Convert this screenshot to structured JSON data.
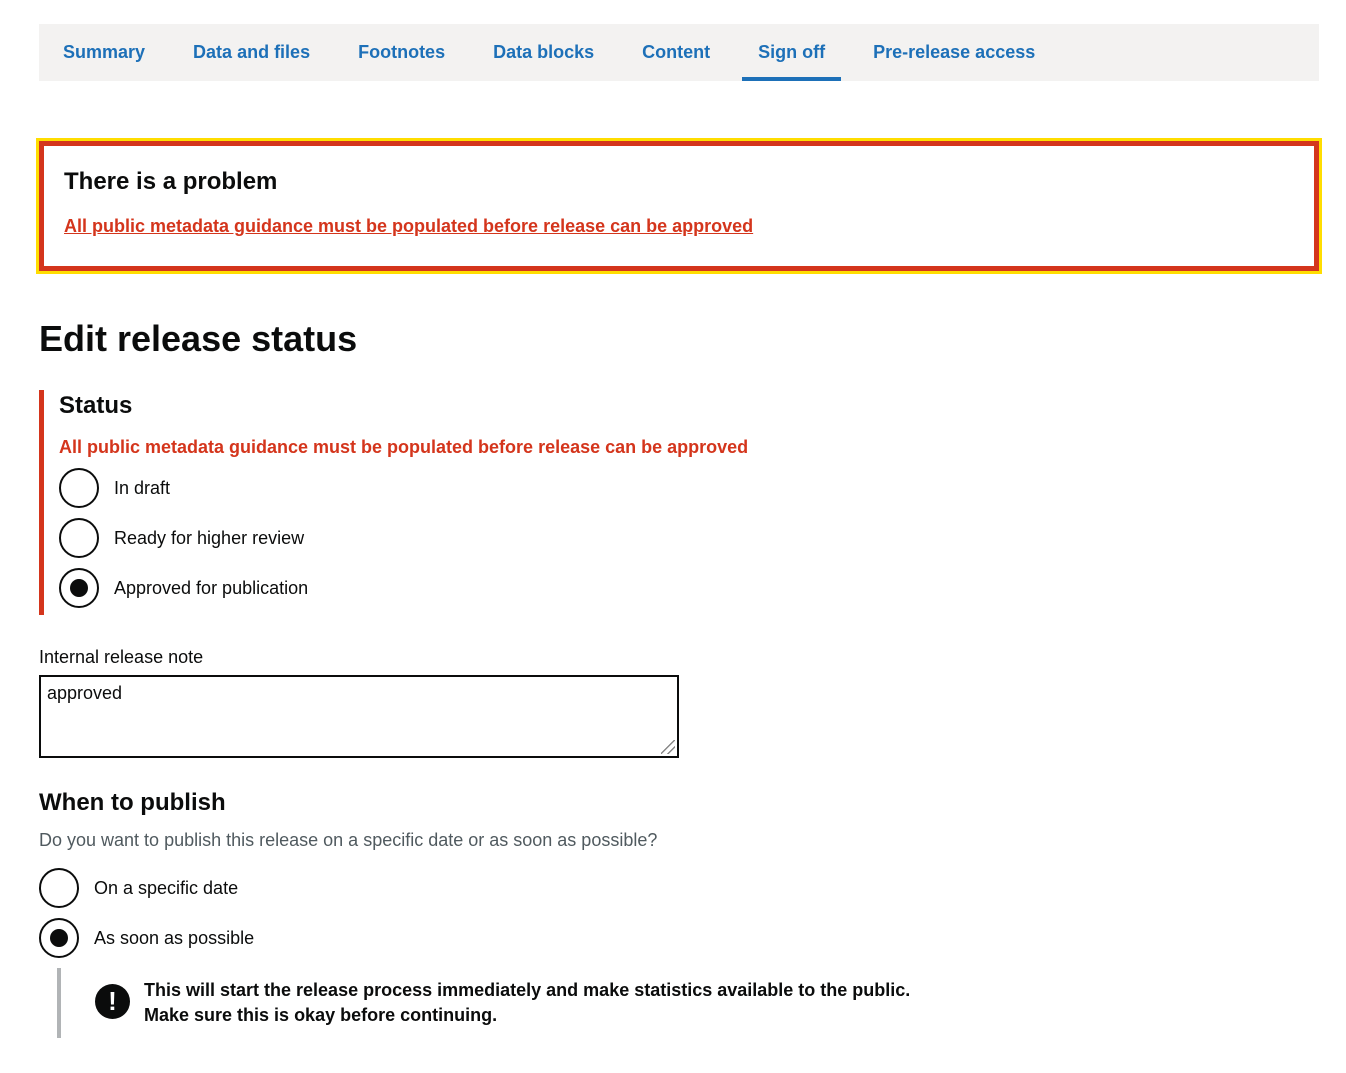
{
  "nav": {
    "tabs": [
      {
        "label": "Summary",
        "active": false
      },
      {
        "label": "Data and files",
        "active": false
      },
      {
        "label": "Footnotes",
        "active": false
      },
      {
        "label": "Data blocks",
        "active": false
      },
      {
        "label": "Content",
        "active": false
      },
      {
        "label": "Sign off",
        "active": true
      },
      {
        "label": "Pre-release access",
        "active": false
      }
    ]
  },
  "error_summary": {
    "title": "There is a problem",
    "link": "All public metadata guidance must be populated before release can be approved"
  },
  "page_title": "Edit release status",
  "status": {
    "legend": "Status",
    "error": "All public metadata guidance must be populated before release can be approved",
    "options": [
      {
        "label": "In draft",
        "checked": false
      },
      {
        "label": "Ready for higher review",
        "checked": false
      },
      {
        "label": "Approved for publication",
        "checked": true
      }
    ]
  },
  "release_note": {
    "label": "Internal release note",
    "value": "approved"
  },
  "when_to_publish": {
    "title": "When to publish",
    "hint": "Do you want to publish this release on a specific date or as soon as possible?",
    "options": [
      {
        "label": "On a specific date",
        "checked": false
      },
      {
        "label": "As soon as possible",
        "checked": true
      }
    ],
    "warning_line1": "This will start the release process immediately and make statistics available to the public.",
    "warning_line2": "Make sure this is okay before continuing.",
    "warning_icon": "exclamation-icon"
  },
  "colors": {
    "link": "#1d70b8",
    "error": "#d4351c",
    "focus": "#ffdd00",
    "nav_bg": "#f3f2f1",
    "text": "#0b0c0c",
    "hint": "#505a5f"
  }
}
